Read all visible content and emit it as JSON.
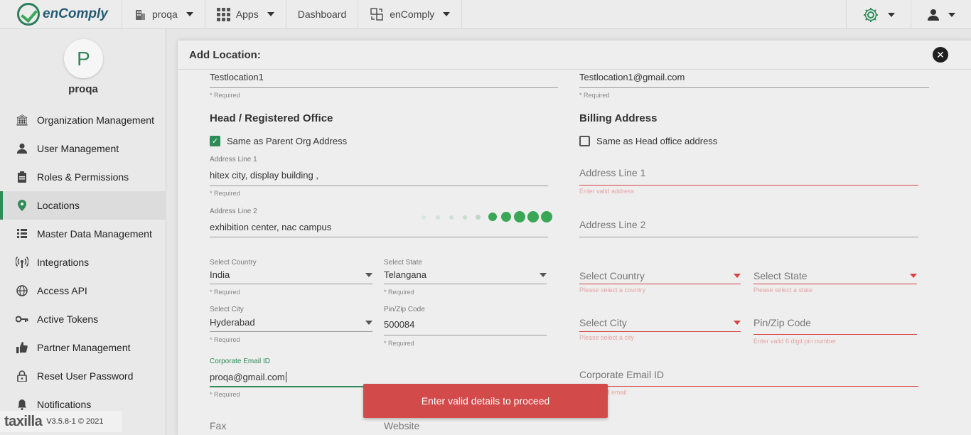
{
  "topbar": {
    "brand": "enComply",
    "org_menu": "proqa",
    "apps_menu": "Apps",
    "dashboard_link": "Dashboard",
    "product_menu": "enComply"
  },
  "sidebar": {
    "avatar_initial": "P",
    "org_name": "proqa",
    "items": [
      {
        "label": "Organization Management",
        "icon": "building-icon"
      },
      {
        "label": "User Management",
        "icon": "user-icon"
      },
      {
        "label": "Roles & Permissions",
        "icon": "clipboard-icon"
      },
      {
        "label": "Locations",
        "icon": "map-pin-icon",
        "active": true
      },
      {
        "label": "Master Data Management",
        "icon": "data-icon"
      },
      {
        "label": "Integrations",
        "icon": "broadcast-icon"
      },
      {
        "label": "Access API",
        "icon": "globe-icon"
      },
      {
        "label": "Active Tokens",
        "icon": "key-icon"
      },
      {
        "label": "Partner Management",
        "icon": "thumbs-up-icon"
      },
      {
        "label": "Reset User Password",
        "icon": "lock-icon"
      },
      {
        "label": "Notifications",
        "icon": "bell-icon"
      }
    ],
    "footer_brand": "taxilla",
    "footer_version": "V3.5.8-1 © 2021"
  },
  "modal": {
    "title": "Add Location:",
    "location_name": "Testlocation1",
    "location_email": "Testlocation1@gmail.com",
    "required": "* Required",
    "head_office": {
      "title": "Head / Registered Office",
      "same_as_parent": "Same as Parent Org Address",
      "address1_label": "Address Line 1",
      "address1_value": "hitex  city, display building ,",
      "address2_label": "Address Line 2",
      "address2_value": "exhibition center, nac campus",
      "country_label": "Select Country",
      "country_value": "India",
      "state_label": "Select State",
      "state_value": "Telangana",
      "city_label": "Select City",
      "city_value": "Hyderabad",
      "pin_label": "Pin/Zip Code",
      "pin_value": "500084",
      "email_label": "Corporate Email ID",
      "email_value": "proqa@gmail.com",
      "fax_placeholder": "Fax",
      "website_placeholder": "Website"
    },
    "billing": {
      "title": "Billing Address",
      "same_as_head": "Same as Head office address",
      "address1_placeholder": "Address Line 1",
      "address1_error": "Enter valid address",
      "address2_placeholder": "Address Line 2",
      "country_placeholder": "Select Country",
      "country_error": "Please select a country",
      "state_placeholder": "Select State",
      "state_error": "Please select a state",
      "city_placeholder": "Select City",
      "city_error": "Please select a city",
      "pin_placeholder": "Pin/Zip Code",
      "pin_error": "Enter valid 6 digit pin number",
      "email_placeholder": "Corporate Email ID",
      "email_error": "Enter valid email"
    }
  },
  "toast": {
    "message": "Enter valid details to proceed"
  },
  "colors": {
    "accent": "#2e8b57",
    "error": "#d64545",
    "toast": "#d24a4a"
  }
}
